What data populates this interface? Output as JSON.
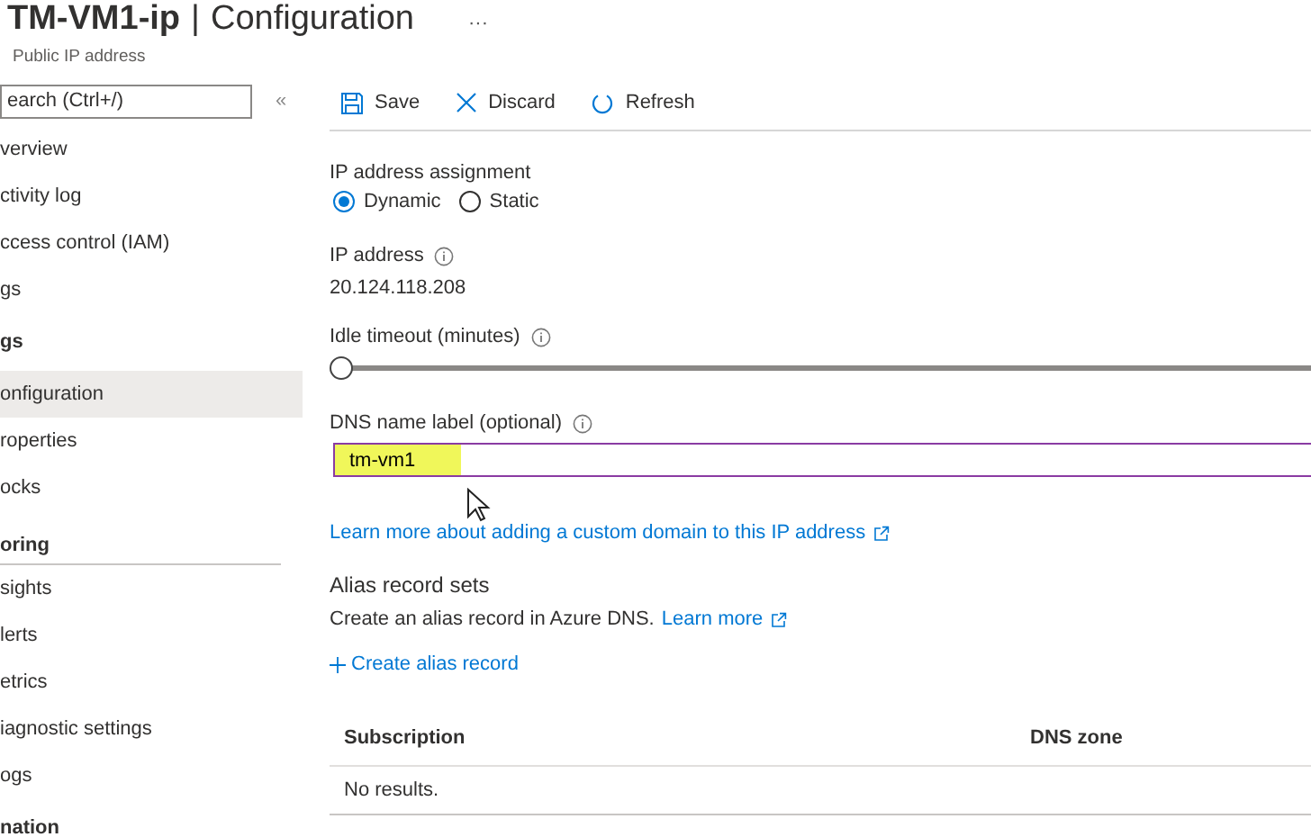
{
  "header": {
    "title": "TM-VM1-ip",
    "separator": "|",
    "section": "Configuration",
    "more": "···",
    "subtitle": "Public IP address"
  },
  "sidebar": {
    "search": {
      "placeholder": "earch (Ctrl+/)"
    },
    "collapse": "«",
    "items": [
      {
        "kind": "item",
        "label": "verview",
        "selected": false
      },
      {
        "kind": "item",
        "label": "ctivity log",
        "selected": false
      },
      {
        "kind": "item",
        "label": "ccess control (IAM)",
        "selected": false
      },
      {
        "kind": "item",
        "label": "gs",
        "selected": false
      },
      {
        "kind": "section",
        "label": "gs"
      },
      {
        "kind": "item",
        "label": "onfiguration",
        "selected": true
      },
      {
        "kind": "item",
        "label": "roperties",
        "selected": false
      },
      {
        "kind": "item",
        "label": "ocks",
        "selected": false
      },
      {
        "kind": "section",
        "label": "oring"
      },
      {
        "kind": "item",
        "label": "sights",
        "selected": false
      },
      {
        "kind": "item",
        "label": "lerts",
        "selected": false
      },
      {
        "kind": "item",
        "label": "etrics",
        "selected": false
      },
      {
        "kind": "item",
        "label": "iagnostic settings",
        "selected": false
      },
      {
        "kind": "item",
        "label": "ogs",
        "selected": false
      },
      {
        "kind": "section",
        "label": "nation"
      }
    ]
  },
  "toolbar": [
    {
      "kind": "save",
      "label": "Save"
    },
    {
      "kind": "discard",
      "label": "Discard"
    },
    {
      "kind": "refresh",
      "label": "Refresh"
    }
  ],
  "assignment": {
    "label": "IP address assignment",
    "options": [
      {
        "label": "Dynamic",
        "selected": true
      },
      {
        "label": "Static",
        "selected": false
      }
    ]
  },
  "ip_address": {
    "label": "IP address",
    "value": "20.124.118.208"
  },
  "idle_timeout": {
    "label": "Idle timeout (minutes)",
    "level": 0
  },
  "dns_label": {
    "label": "DNS name label (optional)",
    "value": "tm-vm1",
    "highlighted": true
  },
  "custom_domain_link": "Learn more about adding a custom domain to this IP address",
  "alias": {
    "title": "Alias record sets",
    "description": "Create an alias record in Azure DNS.",
    "learn_more": "Learn more",
    "create": "Create alias record"
  },
  "table": {
    "columns": [
      "Subscription",
      "DNS zone"
    ],
    "empty": "No results."
  }
}
